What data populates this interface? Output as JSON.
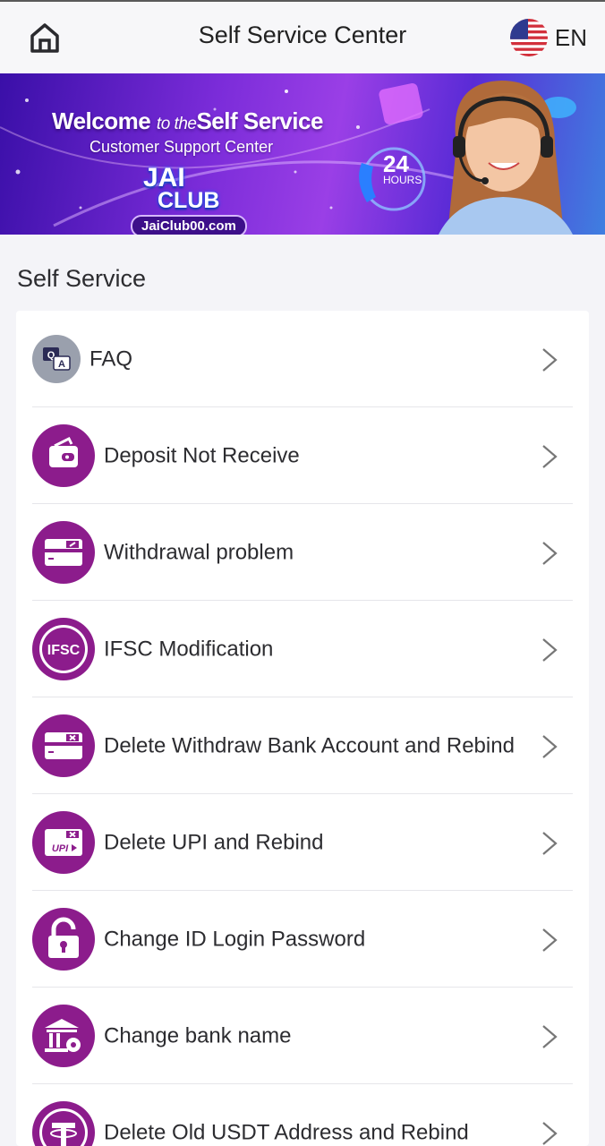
{
  "header": {
    "title": "Self Service Center",
    "language": "EN"
  },
  "banner": {
    "welcome_prefix": "Welcome",
    "welcome_mid": "to the",
    "welcome_suffix": "Self Service",
    "subtitle": "Customer Support Center",
    "logo_line1": "JAI",
    "logo_line2": "CLUB",
    "url": "JaiClub00.com",
    "hours_number": "24",
    "hours_label": "HOURS"
  },
  "section": {
    "title": "Self Service"
  },
  "items": [
    {
      "label": "FAQ",
      "icon": "faq-icon"
    },
    {
      "label": "Deposit Not Receive",
      "icon": "wallet-icon"
    },
    {
      "label": "Withdrawal problem",
      "icon": "card-withdraw-icon"
    },
    {
      "label": "IFSC Modification",
      "icon": "ifsc-icon"
    },
    {
      "label": "Delete Withdraw Bank Account and Rebind",
      "icon": "card-delete-icon"
    },
    {
      "label": "Delete UPI and Rebind",
      "icon": "upi-delete-icon"
    },
    {
      "label": "Change ID Login Password",
      "icon": "lock-icon"
    },
    {
      "label": "Change bank name",
      "icon": "bank-icon"
    },
    {
      "label": "Delete Old USDT Address and Rebind",
      "icon": "usdt-icon"
    }
  ],
  "colors": {
    "accent": "#8c1c8c",
    "background": "#f4f4f8",
    "banner": "#7b2cd9"
  }
}
